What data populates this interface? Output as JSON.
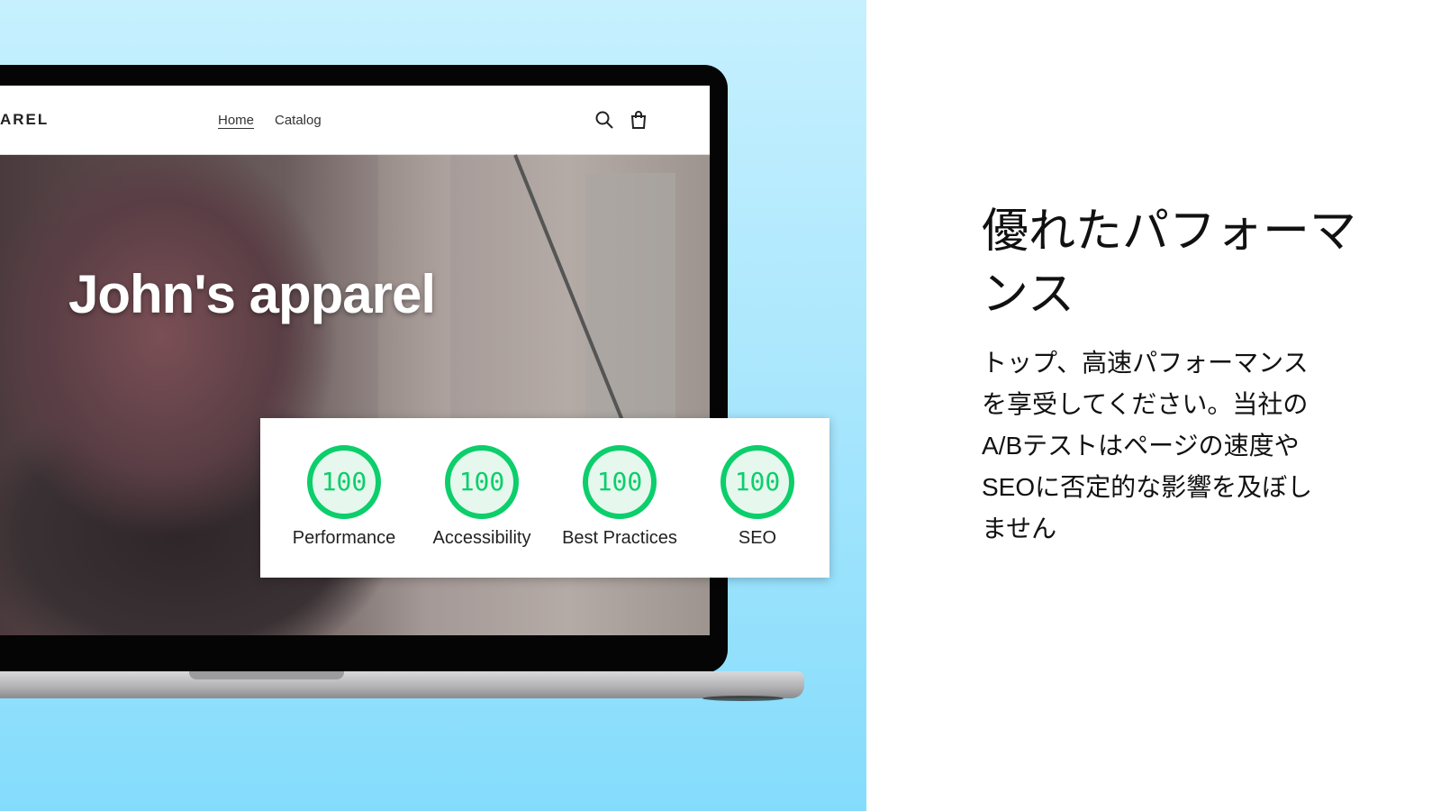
{
  "store": {
    "logo": "AREL",
    "nav": [
      {
        "label": "Home"
      },
      {
        "label": "Catalog"
      }
    ],
    "icons": [
      "search-icon",
      "cart-icon"
    ],
    "hero_title": "John's apparel"
  },
  "scores": [
    {
      "value": "100",
      "label": "Performance"
    },
    {
      "value": "100",
      "label": "Accessibility"
    },
    {
      "value": "100",
      "label": "Best Practices"
    },
    {
      "value": "100",
      "label": "SEO"
    }
  ],
  "colors": {
    "score_green": "#0cce6b",
    "background_top": "#c6f0fe",
    "background_bottom": "#84dcfc"
  },
  "feature": {
    "heading_lines": [
      "優れたパフォーマ",
      "ンス"
    ],
    "body_lines": [
      "トップ、高速パフォーマンス",
      "を享受してください。当社の",
      "A/Bテストはページの速度や",
      "SEOに否定的な影響を及ぼし",
      "ません"
    ]
  }
}
